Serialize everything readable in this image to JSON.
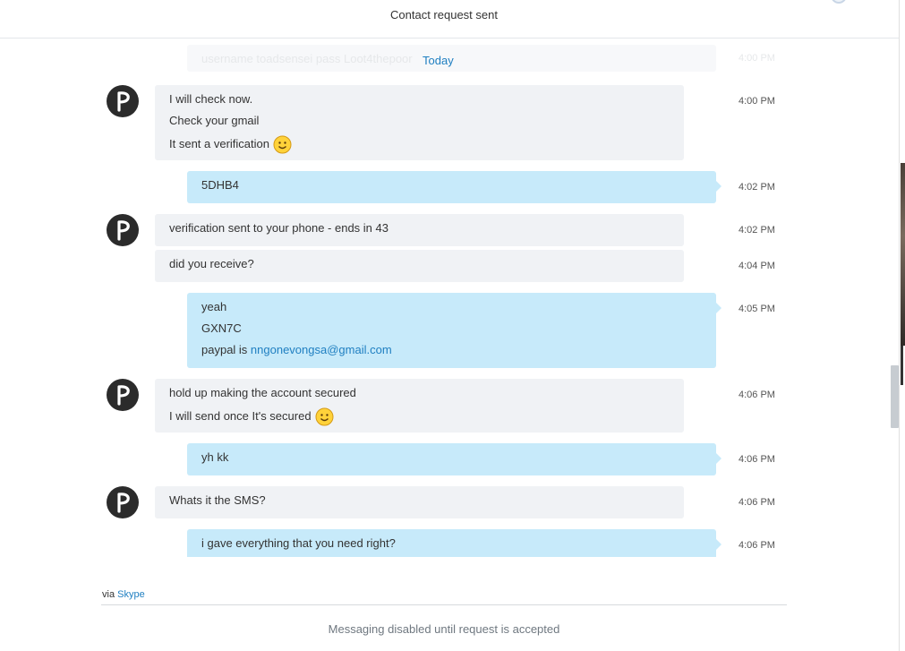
{
  "header": {
    "title": "Contact request sent"
  },
  "ghost": {
    "text": "username toadsensei pass Loot4thepoor",
    "time": "4:00 PM"
  },
  "divider": {
    "label": "Today"
  },
  "contact": {
    "avatar_letter": "p",
    "avatar_color": "#2b2b2b"
  },
  "messages": [
    {
      "dir": "in",
      "lines": [
        "I will check now.",
        "Check your gmail",
        "It sent a verification"
      ],
      "time": "4:00 PM"
    },
    {
      "dir": "out",
      "lines": [
        "5DHB4"
      ],
      "time": "4:02 PM"
    },
    {
      "dir": "in",
      "lines": [
        "verification sent to your phone - ends in 43"
      ],
      "time": "4:02 PM"
    },
    {
      "dir": "in",
      "lines": [
        "did you receive?"
      ],
      "time": "4:04 PM"
    },
    {
      "dir": "out",
      "lines": [
        "yeah",
        "GXN7C",
        "paypal is "
      ],
      "link": "nngonevongsa@gmail.com",
      "time": "4:05 PM"
    },
    {
      "dir": "in",
      "lines": [
        "hold up making the account secured",
        "I will send once It's secured"
      ],
      "time": "4:06 PM"
    },
    {
      "dir": "out",
      "lines": [
        "yh kk"
      ],
      "time": "4:06 PM"
    },
    {
      "dir": "in",
      "lines": [
        "Whats it the SMS?"
      ],
      "time": "4:06 PM"
    },
    {
      "dir": "out",
      "lines": [
        "i gave everything that you need right?"
      ],
      "time": "4:06 PM"
    }
  ],
  "footer": {
    "via_prefix": "via",
    "via_app": "Skype",
    "status": "Messaging disabled until request is accepted"
  },
  "colors": {
    "incoming_bubble": "#f0f2f5",
    "outgoing_bubble": "#c7eafa",
    "link": "#1f7fc1"
  }
}
